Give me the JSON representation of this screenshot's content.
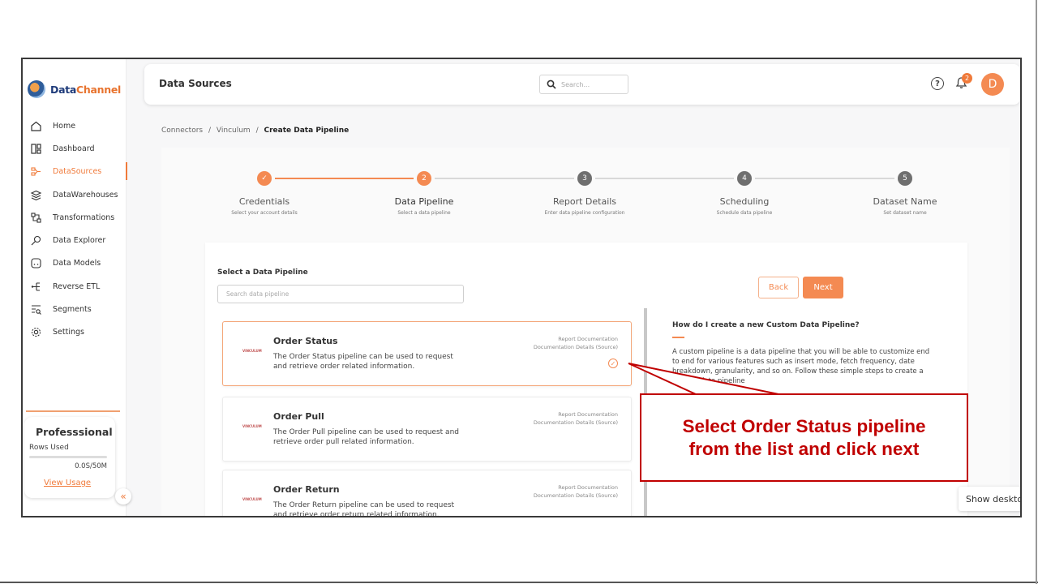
{
  "app": {
    "brand_a": "Data",
    "brand_b": "Channel"
  },
  "sidebar": {
    "items": [
      {
        "label": "Home",
        "icon": "home-icon"
      },
      {
        "label": "Dashboard",
        "icon": "dashboard-icon"
      },
      {
        "label": "DataSources",
        "icon": "datasources-icon",
        "active": true
      },
      {
        "label": "DataWarehouses",
        "icon": "database-icon"
      },
      {
        "label": "Transformations",
        "icon": "transform-icon"
      },
      {
        "label": "Data Explorer",
        "icon": "explorer-icon"
      },
      {
        "label": "Data Models",
        "icon": "models-icon"
      },
      {
        "label": "Reverse ETL",
        "icon": "reverse-etl-icon"
      },
      {
        "label": "Segments",
        "icon": "segments-icon"
      },
      {
        "label": "Settings",
        "icon": "gear-icon"
      }
    ],
    "plan": {
      "title": "Professsional",
      "rows_label": "Rows Used",
      "rows_value": "0.0S/50M",
      "link": "View Usage",
      "collapse": "«"
    }
  },
  "header": {
    "title": "Data Sources",
    "search_placeholder": "Search...",
    "notif_count": "2",
    "avatar": "D",
    "help": "?"
  },
  "breadcrumb": {
    "items": [
      "Connectors",
      "Vinculum"
    ],
    "sep": "/",
    "current": "Create Data Pipeline"
  },
  "steps": [
    {
      "num": "✓",
      "name": "Credentials",
      "sub": "Select your account details",
      "state": "done"
    },
    {
      "num": "2",
      "name": "Data Pipeline",
      "sub": "Select a data pipeline",
      "state": "curr"
    },
    {
      "num": "3",
      "name": "Report Details",
      "sub": "Enter data pipeline configuration",
      "state": "pending"
    },
    {
      "num": "4",
      "name": "Scheduling",
      "sub": "Schedule data pipeline",
      "state": "pending"
    },
    {
      "num": "5",
      "name": "Dataset Name",
      "sub": "Set dataset name",
      "state": "pending"
    }
  ],
  "main": {
    "select_label": "Select a Data Pipeline",
    "search_placeholder": "Search data pipeline",
    "back": "Back",
    "next": "Next",
    "logo_text": "VINCULUM",
    "pipelines": [
      {
        "title": "Order Status",
        "desc": "The Order Status pipeline can be used to request and retrieve order related information.",
        "link1": "Report Documentation",
        "link2": "Documentation Details (Source)",
        "selected": true
      },
      {
        "title": "Order Pull",
        "desc": "The Order Pull pipeline can be used to request and retrieve order pull related information.",
        "link1": "Report Documentation",
        "link2": "Documentation Details (Source)"
      },
      {
        "title": "Order Return",
        "desc": "The Order Return pipeline can be used to request and retrieve order return related information.",
        "link1": "Report Documentation",
        "link2": "Documentation Details (Source)"
      }
    ],
    "help": {
      "title": "How do I create a new Custom Data Pipeline?",
      "text": "A custom pipeline is a data pipeline that you will be able to customize end to end for various features such as insert mode, fetch frequency, date breakdown, granularity, and so on. Follow these simple steps to create a custom data pipeline"
    }
  },
  "annotation": {
    "line1": "Select Order Status pipeline",
    "line2": "from the list and click next"
  },
  "toast": "Show desktop",
  "colors": {
    "accent": "#f48a52",
    "annotation": "#c00000"
  }
}
